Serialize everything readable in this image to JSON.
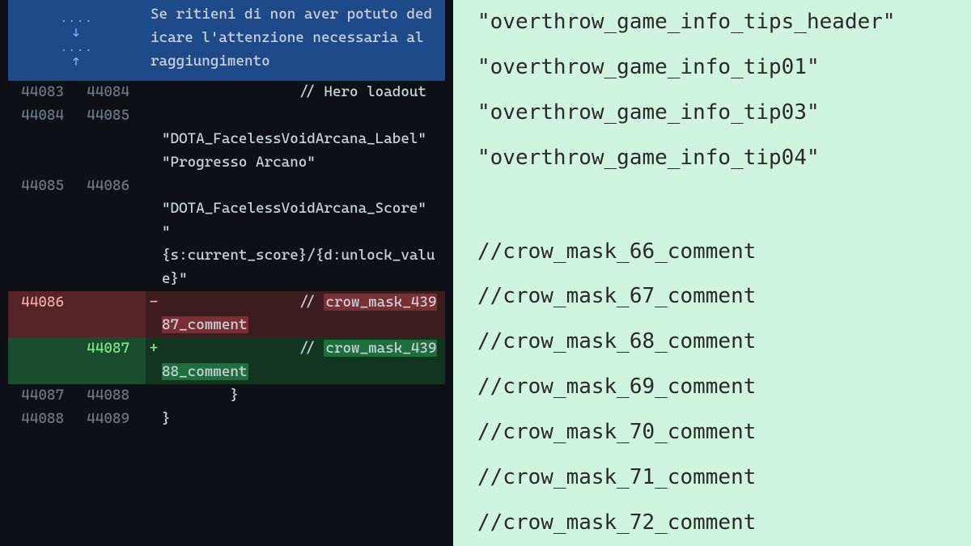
{
  "diff": {
    "header_text": "Se ritieni di non aver potuto dedicare l'attenzione necessaria al raggiungimento",
    "expand_down": "↓",
    "expand_up": "↑",
    "dots": "....",
    "rows": [
      {
        "old": "44083",
        "new": "44084",
        "mark": " ",
        "text": "                // Hero loadout"
      },
      {
        "old": "44084",
        "new": "44085",
        "mark": " ",
        "text": "\n\"DOTA_FacelessVoidArcana_Label\"\n\"Progresso Arcano\""
      },
      {
        "old": "44085",
        "new": "44086",
        "mark": " ",
        "text": "\n\"DOTA_FacelessVoidArcana_Score\"\n\"\n{s:current_score}/{d:unlock_value}\""
      },
      {
        "old": "44086",
        "new": "",
        "mark": "-",
        "class": "del",
        "prefix": "                // ",
        "highlight": "crow_mask_43987_comment"
      },
      {
        "old": "",
        "new": "44087",
        "mark": "+",
        "class": "add",
        "prefix": "                // ",
        "highlight": "crow_mask_43988_comment"
      },
      {
        "old": "44087",
        "new": "44088",
        "mark": " ",
        "text": "        }"
      },
      {
        "old": "44088",
        "new": "44089",
        "mark": " ",
        "text": "}"
      }
    ]
  },
  "right": {
    "lines": [
      "\"overthrow_game_info_tips_header\"",
      "\"overthrow_game_info_tip01\"",
      "\"overthrow_game_info_tip03\"",
      "\"overthrow_game_info_tip04\"",
      "",
      "//crow_mask_66_comment",
      "//crow_mask_67_comment",
      "//crow_mask_68_comment",
      "//crow_mask_69_comment",
      "//crow_mask_70_comment",
      "//crow_mask_71_comment",
      "//crow_mask_72_comment"
    ]
  }
}
